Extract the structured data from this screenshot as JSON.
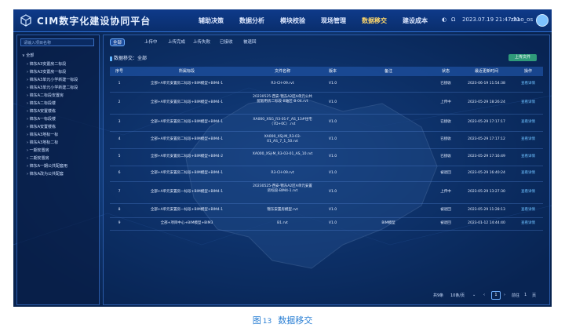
{
  "header": {
    "app_title": "CIM数字化建设协同平台",
    "nav": [
      "辅助决策",
      "数据分析",
      "模块校验",
      "现场管理",
      "数据移交",
      "建设成本"
    ],
    "active_nav": "数据移交",
    "datetime": "2023.07.19  21:47:31",
    "user": "zhao_os"
  },
  "sidebar": {
    "search_placeholder": "请输入项目名称",
    "root": "全部",
    "items": [
      "锦东A3安置房二标段",
      "锦东A3安置房一标段",
      "锦东A3单元小学新建一标段",
      "锦东A3单元小学新建二标段",
      "锦东A二标段安置房",
      "锦东A二标段楼",
      "锦东A安置楼栋",
      "锦东A一标段楼",
      "锦东A安置楼栋",
      "锦东A3地标一标",
      "锦东A3地标二标",
      "一期安置房",
      "二期安置房",
      "锦东A一期公共配套用",
      "锦东A改为公共配套"
    ]
  },
  "tabs": [
    "全部",
    "上传中",
    "上传完成",
    "上传失败",
    "已接收",
    "被退回"
  ],
  "filter_label": "数据移交：全部",
  "upload_button": "上传文件",
  "table": {
    "headers": [
      "序号",
      "所属标段",
      "文件名称",
      "版本",
      "备注",
      "状态",
      "最近更新时间",
      "操作"
    ],
    "rows": [
      {
        "no": "1",
        "section": "全部+A单元安置房二标段+BIM模型+BIM4-1",
        "file": "R3-CH-09.rvt",
        "ver": "V1.0",
        "note": "",
        "status": "已接收",
        "time": "2023-06-19 11:54:38",
        "op": "查看详情"
      },
      {
        "no": "2",
        "section": "全部+A单元安置房二标段+BIM模型+BIM4-1",
        "file": "20230525-西安-锦东A2区A单元公共配套用房二标段-B轴区-B-04.rvt",
        "ver": "V1.0",
        "note": "",
        "status": "上传中",
        "time": "2023-05-29 18:26:24",
        "op": "查看详情"
      },
      {
        "no": "3",
        "section": "全部+A单元安置房二标段+BIM模型+BIM4-1",
        "file": "XA000_XSG_R3-01-F_AS_13#住宅（7D+0C）.rvt",
        "ver": "V1.0",
        "note": "",
        "status": "已接收",
        "time": "2023-05-29 17:17:17",
        "op": "查看详情"
      },
      {
        "no": "4",
        "section": "全部+A单元安置房二标段+BIM模型+BIM4-1",
        "file": "XA000_XSJ-M_R3-03-01_AS_7_1_50.rvt",
        "ver": "V1.0",
        "note": "",
        "status": "已接收",
        "time": "2023-05-29 17:17:12",
        "op": "查看详情"
      },
      {
        "no": "5",
        "section": "全部+A单元安置房二标段+BIM模型+BIM4-2",
        "file": "XA000_XSJ-M_R3-03-01_AS_10.rvt",
        "ver": "V1.0",
        "note": "",
        "status": "已接收",
        "time": "2023-05-29 17:16:49",
        "op": "查看详情"
      },
      {
        "no": "6",
        "section": "全部+A单元安置房二标段+BIM模型+BIM4-1",
        "file": "R3-CH-09.rvt",
        "ver": "V1.0",
        "note": "",
        "status": "被退回",
        "time": "2023-05-29 16:40:24",
        "op": "查看详情"
      },
      {
        "no": "7",
        "section": "全部+A单元安置房一标段+BIM模型+BIM4-1",
        "file": "20230525-西安-锦东A2区A单元安置房标段-BIM4-1.rvt",
        "ver": "V1.0",
        "note": "",
        "status": "上传中",
        "time": "2023-05-29 13:27:30",
        "op": "查看详情"
      },
      {
        "no": "8",
        "section": "全部+A单元安置房一标段+BIM模型+BIM4-1",
        "file": "锦东安置房模型.rvt",
        "ver": "V1.0",
        "note": "",
        "status": "被退回",
        "time": "2023-05-29 11:28:13",
        "op": "查看详情"
      },
      {
        "no": "9",
        "section": "全部+项目中心+BIM模型+BIM3",
        "file": "B1.rvt",
        "ver": "V1.0",
        "note": "BIM模型",
        "status": "被退回",
        "time": "2023-01-12 14:44:40",
        "op": "查看详情"
      }
    ]
  },
  "pager": {
    "total": "共9条",
    "page_size": "10条/页",
    "current": "1",
    "goto_label": "前往",
    "goto_value": "1",
    "page_unit": "页"
  },
  "caption": {
    "prefix": "图",
    "number": "13",
    "title": "数据移交"
  },
  "colors": {
    "header": "#0e3a8a",
    "accent": "#5fb4ff",
    "upload_button": "#2f9b7a",
    "active_nav": "#ffd86b",
    "caption": "#2a7fd4"
  }
}
